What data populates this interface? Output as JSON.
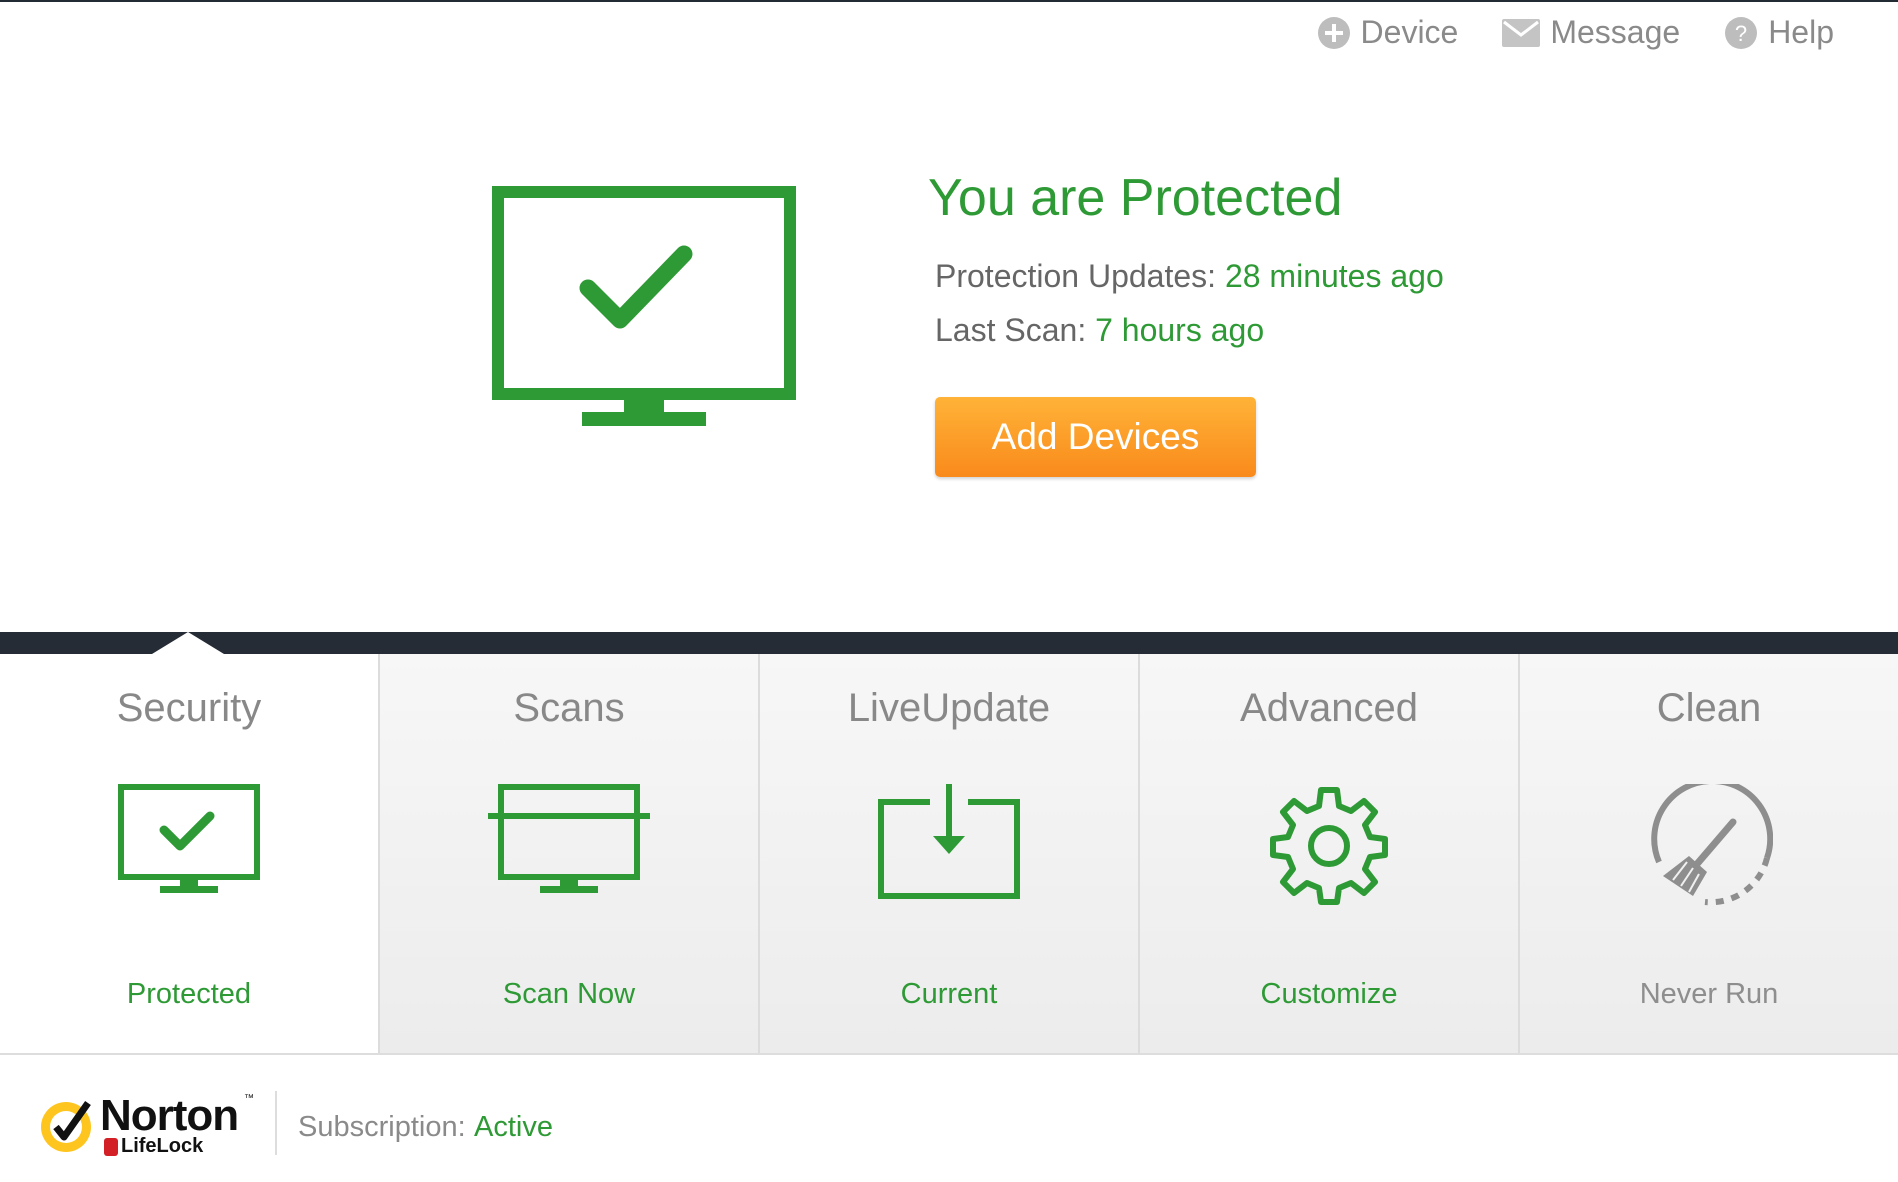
{
  "colors": {
    "accent_green": "#2e9a35",
    "button_orange": "#f98a1b",
    "dark_band": "#252c35",
    "muted_gray": "#8a8a8a"
  },
  "topnav": {
    "items": [
      {
        "label": "Device",
        "icon": "plus-circle-icon"
      },
      {
        "label": "Message",
        "icon": "envelope-icon"
      },
      {
        "label": "Help",
        "icon": "question-circle-icon"
      }
    ]
  },
  "hero": {
    "icon": "monitor-check-icon",
    "title": "You are Protected",
    "updates_label": "Protection Updates:",
    "updates_value": "28 minutes ago",
    "scan_label": "Last Scan:",
    "scan_value": "7 hours ago",
    "button_label": "Add Devices"
  },
  "tabs": [
    {
      "label": "Security",
      "icon": "monitor-check-icon",
      "status": "Protected",
      "active": true
    },
    {
      "label": "Scans",
      "icon": "monitor-scan-icon",
      "status": "Scan Now"
    },
    {
      "label": "LiveUpdate",
      "icon": "download-tray-icon",
      "status": "Current"
    },
    {
      "label": "Advanced",
      "icon": "gear-icon",
      "status": "Customize"
    },
    {
      "label": "Clean",
      "icon": "broom-gauge-icon",
      "status": "Never Run"
    }
  ],
  "footer": {
    "brand": "Norton",
    "sub_brand": "LifeLock",
    "tm": "™",
    "subscription_label": "Subscription:",
    "subscription_value": "Active"
  }
}
